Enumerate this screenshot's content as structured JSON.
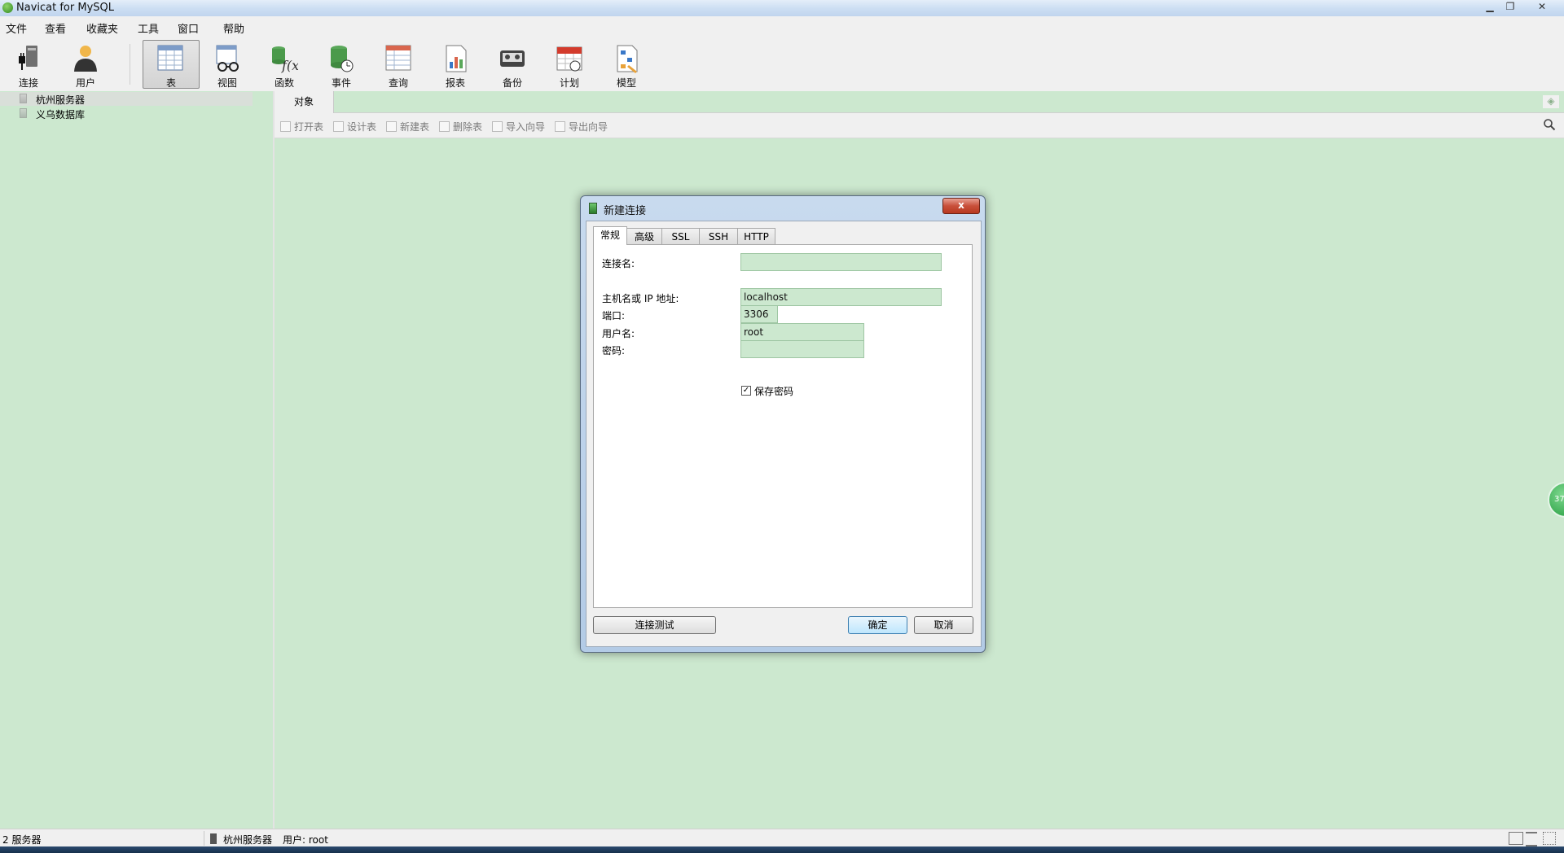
{
  "window": {
    "title": "Navicat for MySQL"
  },
  "menu": [
    "文件",
    "查看",
    "收藏夹",
    "工具",
    "窗口",
    "帮助"
  ],
  "toolbar": [
    {
      "label": "连接",
      "icon": "connection-icon"
    },
    {
      "label": "用户",
      "icon": "user-icon"
    },
    {
      "label": "表",
      "icon": "table-icon",
      "active": true
    },
    {
      "label": "视图",
      "icon": "view-icon"
    },
    {
      "label": "函数",
      "icon": "function-icon"
    },
    {
      "label": "事件",
      "icon": "event-icon"
    },
    {
      "label": "查询",
      "icon": "query-icon"
    },
    {
      "label": "报表",
      "icon": "report-icon"
    },
    {
      "label": "备份",
      "icon": "backup-icon"
    },
    {
      "label": "计划",
      "icon": "schedule-icon"
    },
    {
      "label": "模型",
      "icon": "model-icon"
    }
  ],
  "tree": [
    "杭州服务器",
    "义乌数据库"
  ],
  "tabs": {
    "objects": "对象"
  },
  "object_toolbar": [
    "打开表",
    "设计表",
    "新建表",
    "删除表",
    "导入向导",
    "导出向导"
  ],
  "side_badge": "37",
  "status": {
    "server_count": "2 服务器",
    "current_server": "杭州服务器",
    "user": "用户: root"
  },
  "dialog": {
    "title": "新建连接",
    "close": "x",
    "tabs": [
      "常规",
      "高级",
      "SSL",
      "SSH",
      "HTTP"
    ],
    "fields": {
      "connection_name_label": "连接名:",
      "connection_name_value": "",
      "host_label": "主机名或 IP 地址:",
      "host_value": "localhost",
      "port_label": "端口:",
      "port_value": "3306",
      "username_label": "用户名:",
      "username_value": "root",
      "password_label": "密码:",
      "password_value": "",
      "save_password_label": "保存密码",
      "save_password_checked": true
    },
    "buttons": {
      "test": "连接测试",
      "ok": "确定",
      "cancel": "取消"
    }
  },
  "colors": {
    "background": "#cce8cf",
    "dialog_frame": "#b3cbe6",
    "default_button": "#bee6fd"
  }
}
